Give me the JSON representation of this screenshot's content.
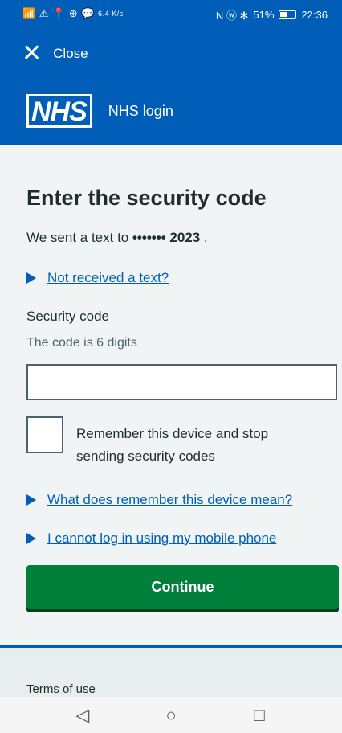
{
  "status_bar": {
    "left_icons": "📶 ⚠ 📍 ⊕ 💬",
    "speed": "6.4 K/s",
    "right_icons": "N ⓦ ✻",
    "battery_percent": "51%",
    "battery_level": 0.51,
    "time": "22:36"
  },
  "header": {
    "close_label": "Close",
    "logo_text": "NHS",
    "brand_name": "NHS login"
  },
  "main": {
    "title": "Enter the security code",
    "sent_prefix": "We sent a text to ",
    "masked_number": "••••••• 2023",
    "sent_suffix": " .",
    "not_received_link": "Not received a text?",
    "code_label": "Security code",
    "code_hint": "The code is 6 digits",
    "code_value": "",
    "remember_label": "Remember this device and stop sending security codes",
    "remember_checked": false,
    "what_remember_link": "What does remember this device mean?",
    "cannot_login_link": "I cannot log in using my mobile phone",
    "continue_label": "Continue"
  },
  "footer": {
    "terms_link": "Terms of use"
  },
  "nav": {
    "back": "◁",
    "home": "○",
    "recents": "□"
  },
  "colors": {
    "nhs_blue": "#005eb8",
    "continue_green": "#007f3b",
    "background": "#f0f4f5"
  }
}
